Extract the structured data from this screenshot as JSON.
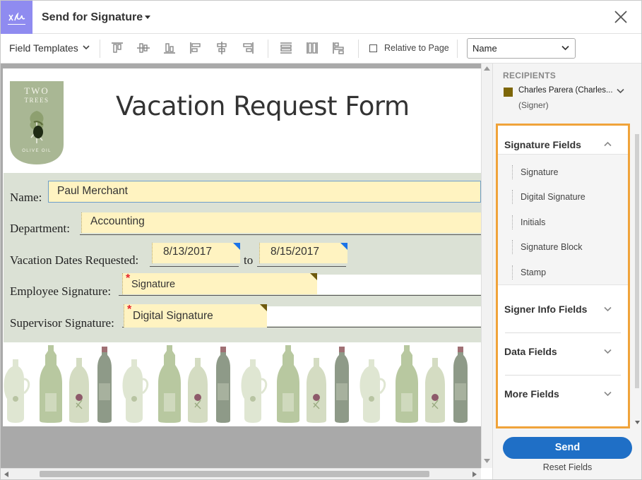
{
  "header": {
    "title": "Send for Signature",
    "logo_icon": "acrobat-sign-icon",
    "close_icon": "close-icon"
  },
  "toolbar": {
    "field_templates_label": "Field Templates",
    "icons": [
      "align-top-icon",
      "align-middle-icon",
      "align-bottom-icon",
      "align-left-icon",
      "align-center-icon",
      "align-right-icon",
      "match-width-icon",
      "match-height-icon",
      "distribute-icon"
    ],
    "relative_to_page_label": "Relative to Page",
    "relative_to_page_checked": false,
    "name_select_value": "Name"
  },
  "document": {
    "logo_text": {
      "top": "TWO",
      "mid": "TREES",
      "bottom": "OLIVE OIL"
    },
    "title": "Vacation Request Form",
    "labels": {
      "name": "Name:",
      "department": "Department:",
      "dates": "Vacation Dates Requested:",
      "to": "to",
      "employee_sig": "Employee Signature:",
      "supervisor_sig": "Supervisor Signature:"
    },
    "fields": {
      "name": "Paul Merchant",
      "department": "Accounting",
      "date_from": "8/13/2017",
      "date_to": "8/15/2017",
      "employee_sig": "Signature",
      "supervisor_sig": "Digital Signature",
      "required_mark": "*"
    }
  },
  "panel": {
    "recipients_title": "RECIPIENTS",
    "recipient_name": "Charles Parera (Charles...",
    "recipient_role": "(Signer)",
    "recipient_color": "#7d6608",
    "sections": {
      "signature": "Signature Fields",
      "signer_info": "Signer Info Fields",
      "data": "Data Fields",
      "more": "More Fields"
    },
    "signature_items": [
      "Signature",
      "Digital Signature",
      "Initials",
      "Signature Block",
      "Stamp"
    ],
    "send_label": "Send",
    "reset_label": "Reset Fields",
    "highlight_color": "#f0a33a",
    "accent_color": "#1f6fc6"
  }
}
